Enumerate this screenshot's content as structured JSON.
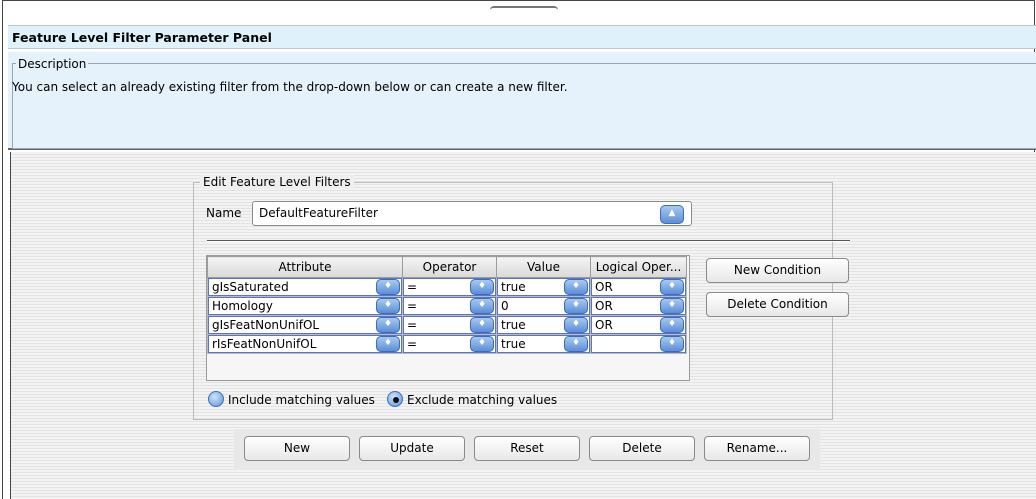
{
  "panel": {
    "title": "Feature Level Filter Parameter Panel",
    "description_legend": "Description",
    "description_text": "You can select an already existing filter from the drop-down below or can create a new filter."
  },
  "editor": {
    "group_title": "Edit Feature Level Filters",
    "name_label": "Name",
    "name_value": "DefaultFeatureFilter",
    "columns": [
      "Attribute",
      "Operator",
      "Value",
      "Logical Oper..."
    ],
    "rows": [
      {
        "attribute": "gIsSaturated",
        "operator": "=",
        "value": "true",
        "logical": "OR"
      },
      {
        "attribute": "Homology",
        "operator": "=",
        "value": "0",
        "logical": "OR"
      },
      {
        "attribute": "gIsFeatNonUnifOL",
        "operator": "=",
        "value": "true",
        "logical": "OR"
      },
      {
        "attribute": "rIsFeatNonUnifOL",
        "operator": "=",
        "value": "true",
        "logical": ""
      }
    ],
    "new_condition": "New Condition",
    "delete_condition": "Delete Condition",
    "include_label": "Include matching values",
    "exclude_label": "Exclude matching values",
    "selected_radio": "exclude"
  },
  "actions": {
    "new": "New",
    "update": "Update",
    "reset": "Reset",
    "delete": "Delete",
    "rename": "Rename..."
  },
  "colors": {
    "title_bg": "#dff2fb",
    "spinner": "#5b8fd8"
  }
}
